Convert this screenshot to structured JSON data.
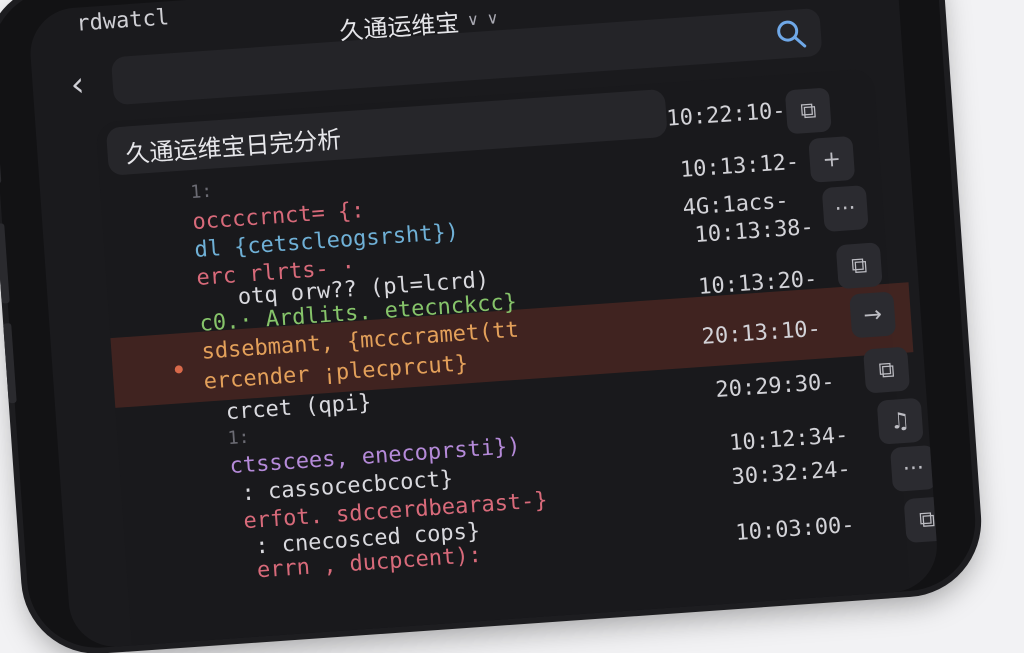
{
  "status_text": "rdwatcl",
  "nav": {
    "title": "久通运维宝",
    "back_icon": "chevron-left-icon",
    "search_icon": "search-icon"
  },
  "log_header": {
    "title": "久通运维宝日完分析"
  },
  "code_lines": [
    {
      "num": "1:",
      "text": "",
      "color": "#d9d9de"
    },
    {
      "num": "",
      "text": "occccrnct= {:",
      "color": "#d86a7a"
    },
    {
      "num": "",
      "text": "dl {cetscleogsrsht})",
      "color": "#6fb0d6"
    },
    {
      "num": "",
      "text": "erc rlrts-   ·",
      "color": "#d86a7a"
    },
    {
      "num": "",
      "text": "otq orw?? (pl=lcrd)",
      "color": "#d9d9de"
    },
    {
      "num": "",
      "text": "c0.· Ardlits. etecnckcc}",
      "color": "#86c46a"
    },
    {
      "num": "",
      "text": "sdsebmant, {mcccramet(tt",
      "color": "#e3a05a"
    },
    {
      "num": "",
      "text": "ercender  ¡plecprcut}",
      "color": "#e3a05a"
    },
    {
      "num": "",
      "text": "crcet (qpi}",
      "color": "#d9d9de"
    },
    {
      "num": "1:",
      "text": "",
      "color": "#d9d9de"
    },
    {
      "num": "",
      "text": "ctsscees, enecoprsti})",
      "color": "#b58ad9"
    },
    {
      "num": "",
      "text": ":  cassocecbcoct}",
      "color": "#d9d9de"
    },
    {
      "num": "",
      "text": "erfot. sdccerdbearast-}",
      "color": "#d86a7a"
    },
    {
      "num": "",
      "text": ":  cnecosced cops}",
      "color": "#d9d9de"
    },
    {
      "num": "",
      "text": "errn , ducpcent):",
      "color": "#d86a7a"
    }
  ],
  "timestamps": [
    "10:22:10-",
    "10:13:12-",
    "4G:1acs-",
    "10:13:38-",
    "10:13:20-",
    "20:13:10-",
    "20:29:30-",
    "10:12:34-",
    "30:32:24-",
    "10:03:00-"
  ],
  "actions": [
    {
      "icon": "copy-icon",
      "glyph": "⧉"
    },
    {
      "icon": "plus-icon",
      "glyph": "+"
    },
    {
      "icon": "more-icon",
      "glyph": "···"
    },
    {
      "icon": "copy-icon",
      "glyph": "⧉"
    },
    {
      "icon": "arrow-right-icon",
      "glyph": "→"
    },
    {
      "icon": "copy-icon",
      "glyph": "⧉"
    },
    {
      "icon": "share-icon",
      "glyph": "♫"
    },
    {
      "icon": "more-icon",
      "glyph": "···"
    },
    {
      "icon": "copy-icon",
      "glyph": "⧉"
    }
  ],
  "colors": {
    "background": "#1a1a1d",
    "highlight": "#963c28",
    "accent": "#6fa8e8"
  }
}
